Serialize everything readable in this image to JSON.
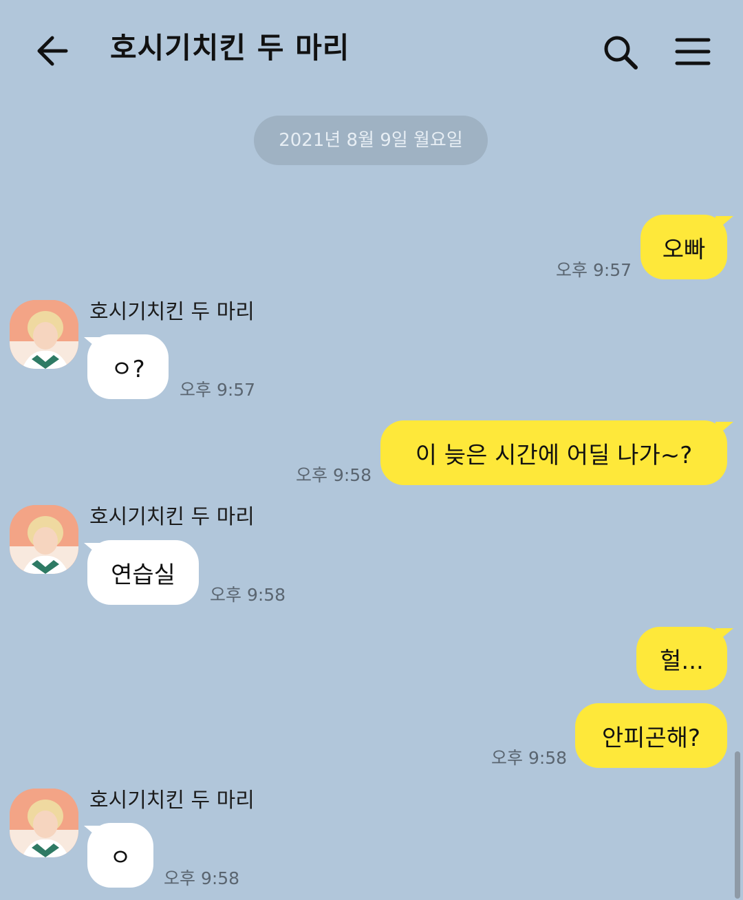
{
  "header": {
    "title": "호시기치킨 두 마리",
    "back_icon": "arrow-left-icon",
    "search_icon": "search-icon",
    "menu_icon": "hamburger-menu-icon"
  },
  "date_divider": "2021년 8월 9일 월요일",
  "colors": {
    "background": "#b1c6da",
    "my_bubble": "#fee83a",
    "their_bubble": "#ffffff",
    "date_pill": "#9fb2c3"
  },
  "messages": [
    {
      "from": "me",
      "text": "오빠",
      "time": "오후 9:57"
    },
    {
      "from": "them",
      "sender": "호시기치킨 두 마리",
      "text": "ㅇ?",
      "time": "오후 9:57"
    },
    {
      "from": "me",
      "text": "이 늦은 시간에 어딜 나가~?",
      "time": "오후 9:58"
    },
    {
      "from": "them",
      "sender": "호시기치킨 두 마리",
      "text": "연습실",
      "time": "오후 9:58"
    },
    {
      "from": "me",
      "text": "헐...",
      "time": ""
    },
    {
      "from": "me",
      "text": "안피곤해?",
      "time": "오후 9:58"
    },
    {
      "from": "them",
      "sender": "호시기치킨 두 마리",
      "text": "ㅇ",
      "time": "오후 9:58"
    }
  ]
}
